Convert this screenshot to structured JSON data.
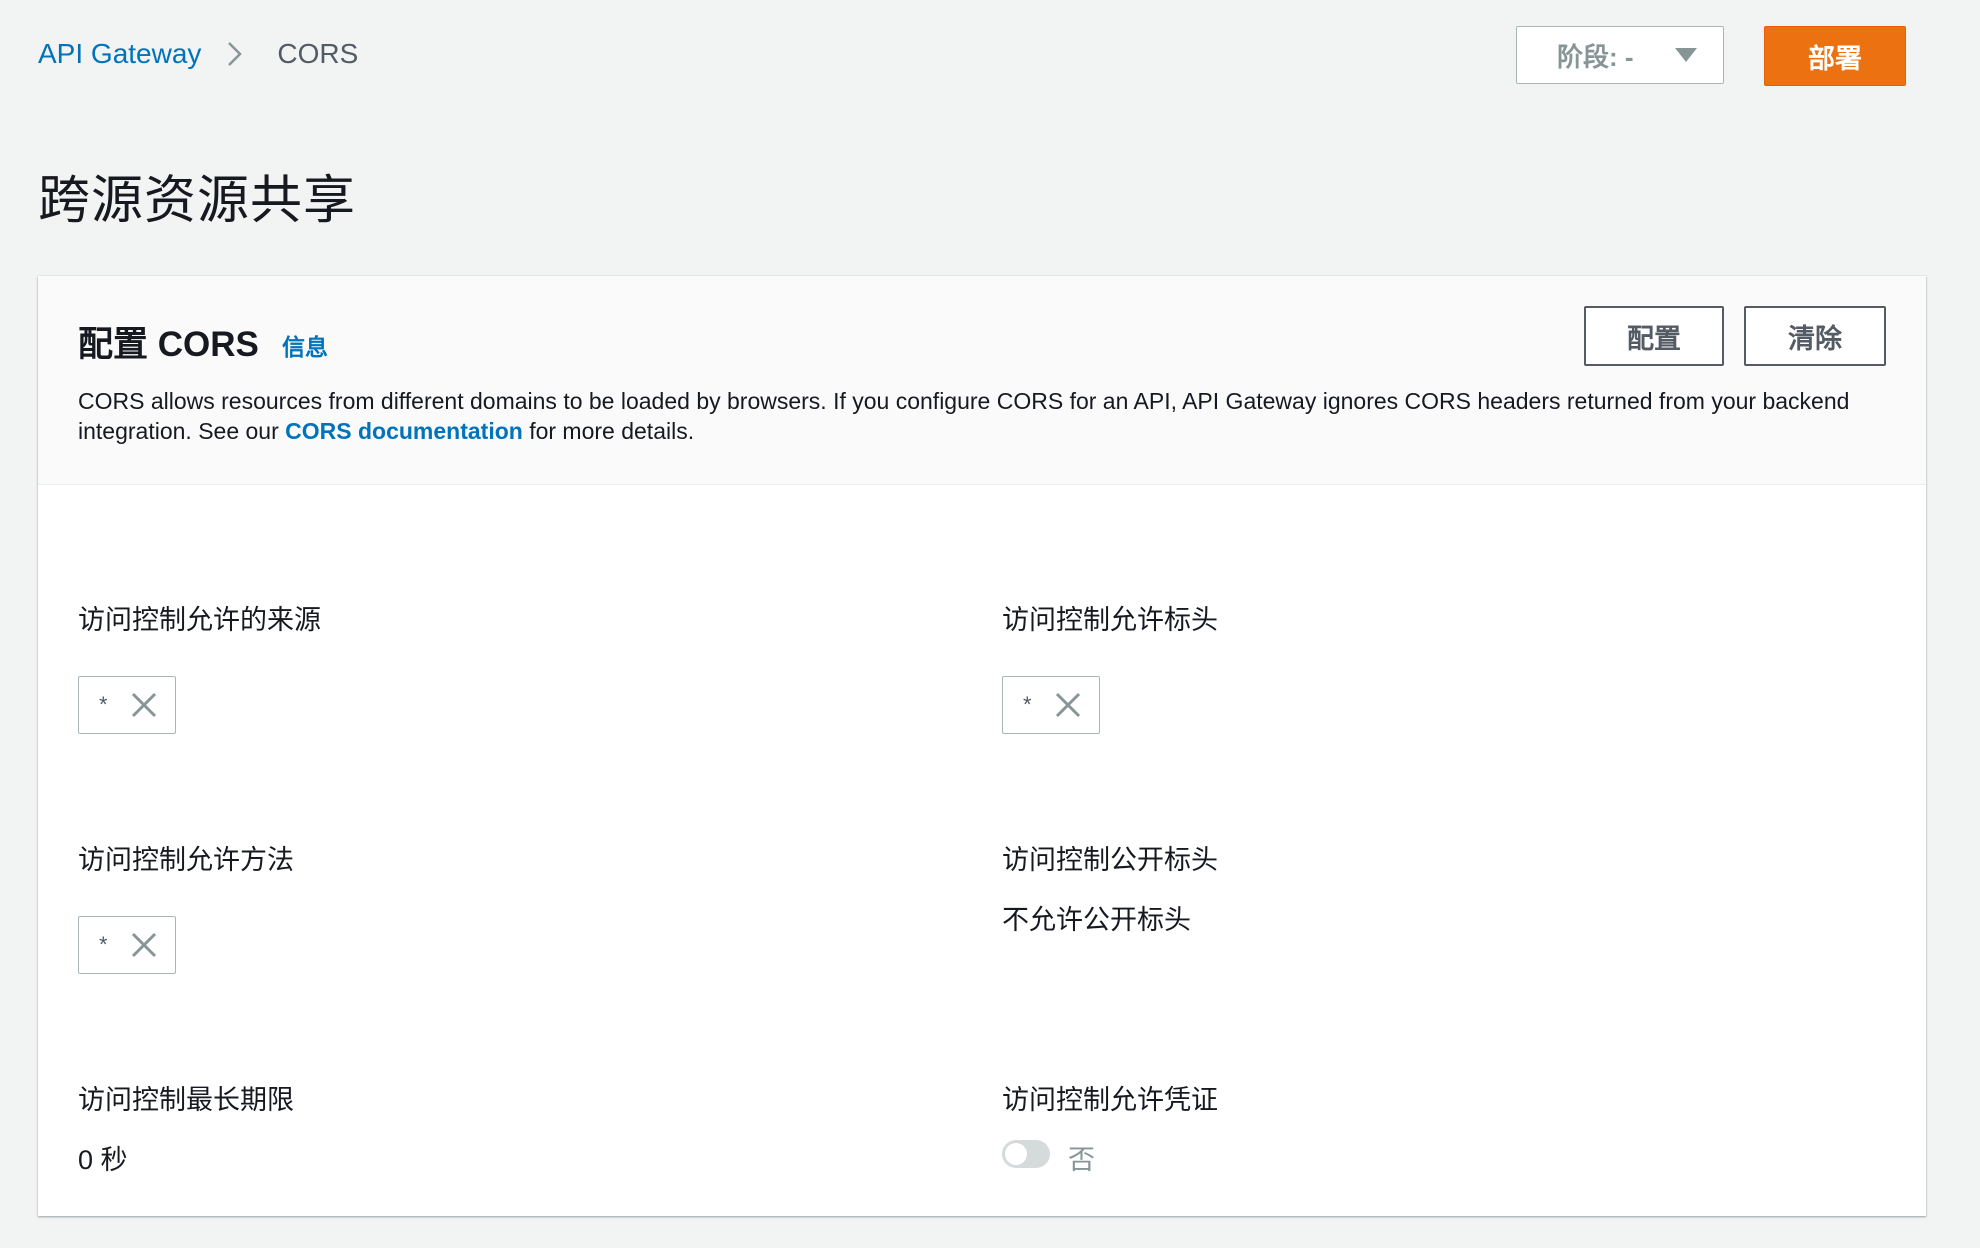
{
  "breadcrumb": {
    "root": "API Gateway",
    "current": "CORS"
  },
  "header": {
    "stage_label": "阶段: -",
    "deploy_label": "部署"
  },
  "page": {
    "title": "跨源资源共享"
  },
  "panel": {
    "title": "配置 CORS",
    "info_link": "信息",
    "configure_label": "配置",
    "clear_label": "清除",
    "description_before": "CORS allows resources from different domains to be loaded by browsers. If you configure CORS for an API, API Gateway ignores CORS headers returned from your backend integration. See our ",
    "description_link": "CORS documentation",
    "description_after": " for more details."
  },
  "fields": {
    "allow_origins": {
      "label": "访问控制允许的来源",
      "tokens": [
        "*"
      ]
    },
    "allow_headers": {
      "label": "访问控制允许标头",
      "tokens": [
        "*"
      ]
    },
    "allow_methods": {
      "label": "访问控制允许方法",
      "tokens": [
        "*"
      ]
    },
    "expose_headers": {
      "label": "访问控制公开标头",
      "value": "不允许公开标头"
    },
    "max_age": {
      "label": "访问控制最长期限",
      "value": "0 秒"
    },
    "allow_credentials": {
      "label": "访问控制允许凭证",
      "enabled": false,
      "state_label": "否"
    }
  },
  "icons": {
    "breadcrumb_separator": "chevron-right-icon",
    "stage_dropdown": "caret-down-icon",
    "token_remove": "close-icon"
  },
  "colors": {
    "link": "#0073bb",
    "primary_button": "#ec7211",
    "background": "#f2f3f3"
  }
}
